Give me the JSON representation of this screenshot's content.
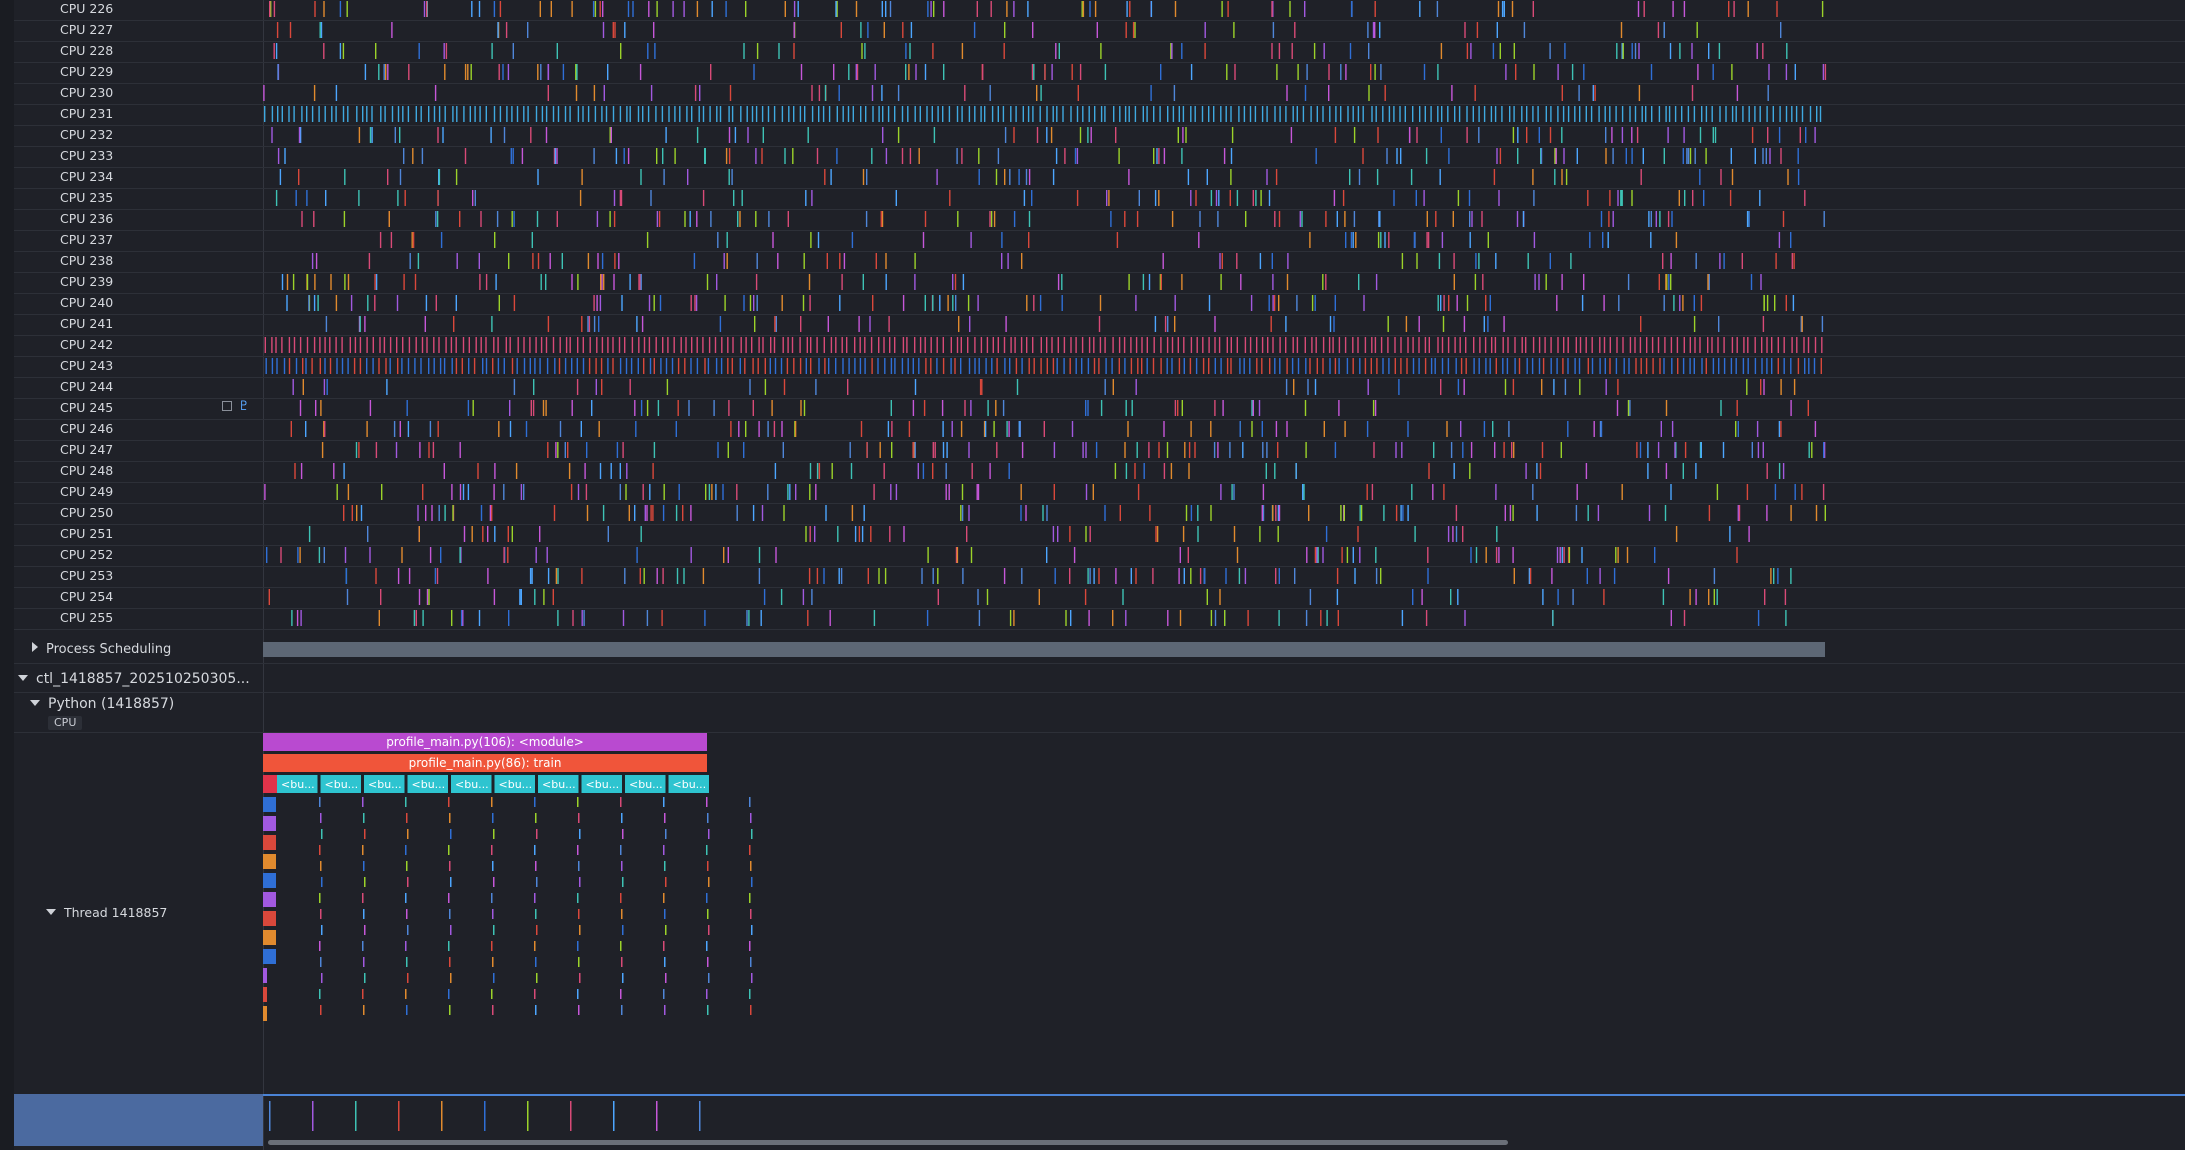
{
  "cpu_rows": [
    {
      "label": "CPU 226"
    },
    {
      "label": "CPU 227"
    },
    {
      "label": "CPU 228"
    },
    {
      "label": "CPU 229"
    },
    {
      "label": "CPU 230"
    },
    {
      "label": "CPU 231"
    },
    {
      "label": "CPU 232"
    },
    {
      "label": "CPU 233"
    },
    {
      "label": "CPU 234"
    },
    {
      "label": "CPU 235"
    },
    {
      "label": "CPU 236"
    },
    {
      "label": "CPU 237"
    },
    {
      "label": "CPU 238"
    },
    {
      "label": "CPU 239"
    },
    {
      "label": "CPU 240"
    },
    {
      "label": "CPU 241"
    },
    {
      "label": "CPU 242"
    },
    {
      "label": "CPU 243"
    },
    {
      "label": "CPU 244"
    },
    {
      "label": "CPU 245",
      "icons": [
        "checkbox-icon",
        "pin-icon"
      ]
    },
    {
      "label": "CPU 246"
    },
    {
      "label": "CPU 247"
    },
    {
      "label": "CPU 248"
    },
    {
      "label": "CPU 249"
    },
    {
      "label": "CPU 250"
    },
    {
      "label": "CPU 251"
    },
    {
      "label": "CPU 252"
    },
    {
      "label": "CPU 253"
    },
    {
      "label": "CPU 254"
    },
    {
      "label": "CPU 255"
    }
  ],
  "process_scheduling": {
    "label": "Process Scheduling"
  },
  "process": {
    "label": "ctl_1418857_202510250305..."
  },
  "python": {
    "label": "Python (1418857)",
    "cpu_chip": "CPU"
  },
  "thread": {
    "label": "Thread 1418857"
  },
  "flame": {
    "frames": [
      {
        "text": "profile_main.py(106): <module>",
        "color": "#b94ad0"
      },
      {
        "text": "profile_main.py(86): train",
        "color": "#f0553a"
      }
    ],
    "call_labels": [
      "<bu...",
      "<bu...",
      "<bu...",
      "<bu...",
      "<bu...",
      "<bu...",
      "<bu...",
      "<bu...",
      "<bu...",
      "<bu..."
    ],
    "call_color": "#2ec4d0"
  },
  "colors": {
    "background": "#1f2128",
    "slice_palette": [
      "#4f86d9",
      "#a259e0",
      "#3ec2b5",
      "#d9483b",
      "#e08a2e",
      "#2f6fd6",
      "#9bd22a",
      "#d84a77",
      "#4da6ff",
      "#c657d9"
    ]
  }
}
